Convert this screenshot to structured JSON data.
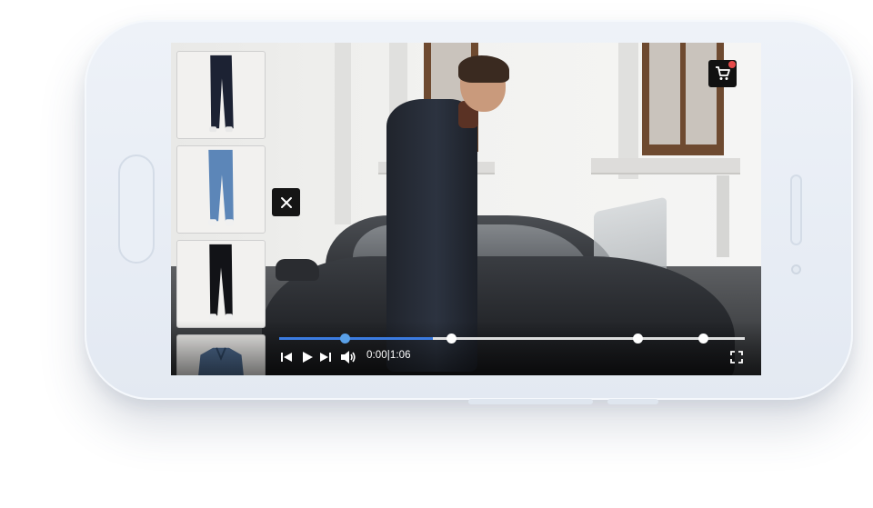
{
  "player": {
    "current_time": "0:00",
    "separator": "|",
    "duration": "1:06",
    "progress_fraction": 0.33,
    "chapter_markers": [
      0.14,
      0.37,
      0.77,
      0.91
    ],
    "accent_color": "#3b7be0"
  },
  "overlay": {
    "cart_has_items": true,
    "cart_badge_color": "#e64a4a"
  },
  "products": [
    {
      "icon": "dark-jeans-thumbnail",
      "color": "#1c2233"
    },
    {
      "icon": "light-blue-jeans-thumbnail",
      "color": "#5c86b8"
    },
    {
      "icon": "black-jeans-thumbnail",
      "color": "#121317"
    },
    {
      "icon": "denim-jacket-thumbnail",
      "color": "#4f6d93"
    }
  ]
}
